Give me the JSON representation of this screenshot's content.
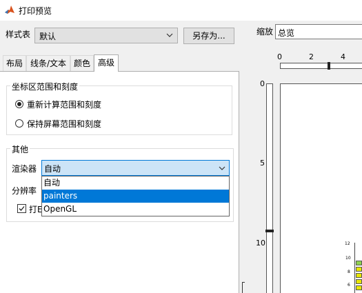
{
  "window": {
    "title": "打印预览"
  },
  "toolbar": {
    "stylesheet_label": "样式表",
    "stylesheet_value": "默认",
    "save_as_label": "另存为...",
    "zoom_label": "缩放",
    "zoom_value": "总览"
  },
  "tabs": [
    {
      "label": "布局"
    },
    {
      "label": "线条/文本"
    },
    {
      "label": "颜色"
    },
    {
      "label": "高级"
    }
  ],
  "axes_group": {
    "title": "坐标区范围和刻度",
    "options": [
      {
        "label": "重新计算范围和刻度",
        "selected": true
      },
      {
        "label": "保持屏幕范围和刻度",
        "selected": false
      }
    ]
  },
  "other_group": {
    "title": "其他",
    "renderer_label": "渲染器",
    "renderer_value": "自动",
    "renderer_options": [
      {
        "label": "自动",
        "highlighted": false
      },
      {
        "label": "painters",
        "highlighted": true
      },
      {
        "label": "OpenGL",
        "highlighted": false
      }
    ],
    "resolution_label": "分辨率",
    "print_checkbox_label": "打E"
  },
  "ruler": {
    "horizontal_ticks": [
      "0",
      "2",
      "4"
    ],
    "vertical_ticks": [
      "0",
      "5",
      "10"
    ]
  },
  "mini_chart": {
    "tick_labels": [
      "12",
      "10",
      "8",
      "6"
    ]
  },
  "colors": {
    "accent": "#0078d7",
    "dropdown_highlight": "#cce4f7",
    "bar_fill": "#e8e600",
    "bar_green": "#8fd14f"
  }
}
